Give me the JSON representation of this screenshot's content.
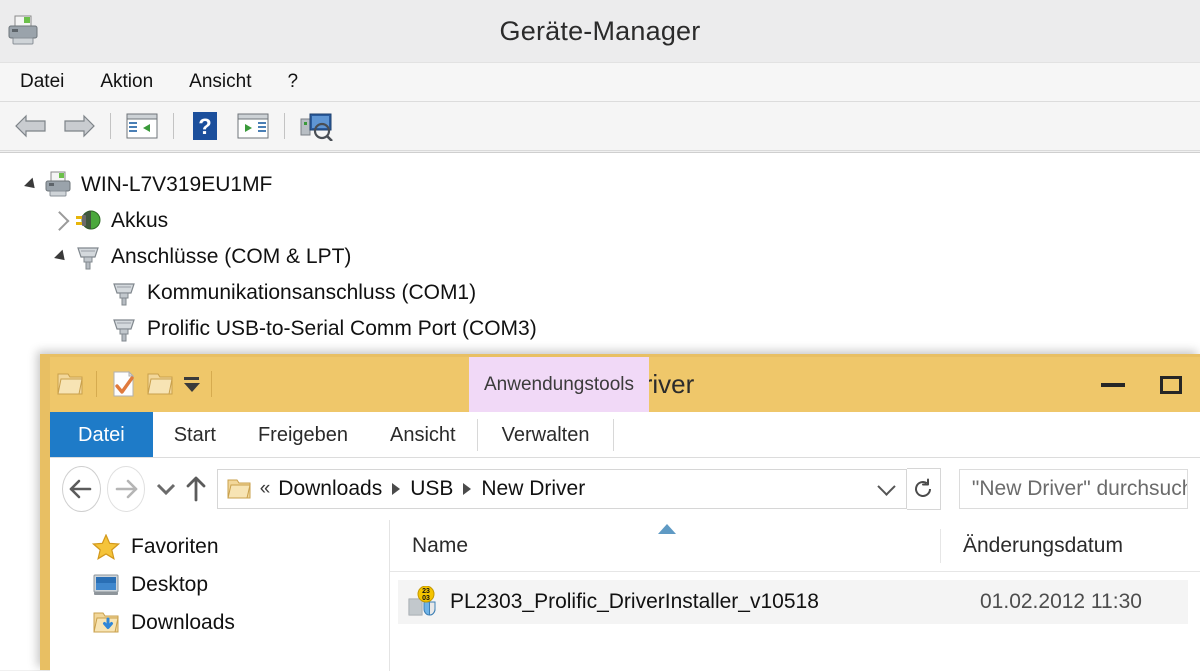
{
  "device_manager": {
    "title": "Geräte-Manager",
    "system_icon": "printer-device-icon",
    "menu": [
      {
        "label": "Datei",
        "name": "menu-datei"
      },
      {
        "label": "Aktion",
        "name": "menu-aktion"
      },
      {
        "label": "Ansicht",
        "name": "menu-ansicht"
      },
      {
        "label": "?",
        "name": "menu-help"
      }
    ],
    "toolbar": [
      {
        "icon": "back-arrow-icon"
      },
      {
        "icon": "forward-arrow-icon"
      },
      {
        "icon": "show-hide-console-tree-icon"
      },
      {
        "icon": "help-icon"
      },
      {
        "icon": "properties-icon"
      },
      {
        "icon": "scan-hardware-changes-icon"
      }
    ],
    "tree": [
      {
        "label": "WIN-L7V319EU1MF",
        "level": 0,
        "expander": "open",
        "icon": "computer-icon"
      },
      {
        "label": "Akkus",
        "level": 1,
        "expander": "closed",
        "icon": "battery-icon"
      },
      {
        "label": "Anschlüsse (COM & LPT)",
        "level": 1,
        "expander": "open",
        "icon": "port-icon"
      },
      {
        "label": "Kommunikationsanschluss (COM1)",
        "level": 2,
        "expander": "none",
        "icon": "port-icon"
      },
      {
        "label": "Prolific USB-to-Serial Comm Port (COM3)",
        "level": 2,
        "expander": "none",
        "icon": "port-icon"
      }
    ]
  },
  "explorer": {
    "title": "New Driver",
    "contextual_tab_group": "Anwendungstools",
    "quick_access": [
      {
        "icon": "folder-icon",
        "name": "qat-folder"
      },
      {
        "icon": "properties-icon",
        "name": "qat-properties"
      },
      {
        "icon": "new-folder-icon",
        "name": "qat-new-folder"
      },
      {
        "icon": "chevron-down-icon",
        "name": "qat-customize"
      }
    ],
    "window_buttons": [
      {
        "name": "minimize-button",
        "icon": "minimize-icon"
      },
      {
        "name": "maximize-button",
        "icon": "maximize-icon"
      }
    ],
    "tabs": [
      {
        "label": "Datei",
        "name": "tab-datei",
        "active": true
      },
      {
        "label": "Start",
        "name": "tab-start",
        "active": false
      },
      {
        "label": "Freigeben",
        "name": "tab-freigeben",
        "active": false
      },
      {
        "label": "Ansicht",
        "name": "tab-ansicht",
        "active": false
      },
      {
        "label": "Verwalten",
        "name": "tab-verwalten",
        "active": false
      }
    ],
    "address_bar": {
      "back_icon": "back-arrow-icon",
      "forward_icon": "forward-arrow-icon",
      "history_icon": "chevron-down-icon",
      "up_icon": "up-arrow-icon",
      "folder_icon": "folder-icon",
      "overflow": "«",
      "crumbs": [
        "Downloads",
        "USB",
        "New Driver"
      ],
      "dropdown_icon": "chevron-down-icon",
      "refresh_icon": "refresh-icon"
    },
    "search": {
      "placeholder": "\"New Driver\" durchsuchen"
    },
    "nav_pane": [
      {
        "label": "Favoriten",
        "icon": "star-icon",
        "name": "nav-favoriten"
      },
      {
        "label": "Desktop",
        "icon": "desktop-icon",
        "name": "nav-desktop"
      },
      {
        "label": "Downloads",
        "icon": "downloads-folder-icon",
        "name": "nav-downloads"
      }
    ],
    "columns": [
      {
        "label": "Name",
        "name": "column-name",
        "sorted": "asc"
      },
      {
        "label": "Änderungsdatum",
        "name": "column-date",
        "sorted": "none"
      }
    ],
    "files": [
      {
        "name": "PL2303_Prolific_DriverInstaller_v10518",
        "date": "01.02.2012 11:30",
        "icon": "installer-exe-icon",
        "badge": "23 03"
      }
    ]
  },
  "colors": {
    "explorer_frame": "#efc76a",
    "file_tab": "#1e7bc8",
    "contextual_tab": "#f1d9f7",
    "sort_arrow": "#5f9ac4"
  }
}
